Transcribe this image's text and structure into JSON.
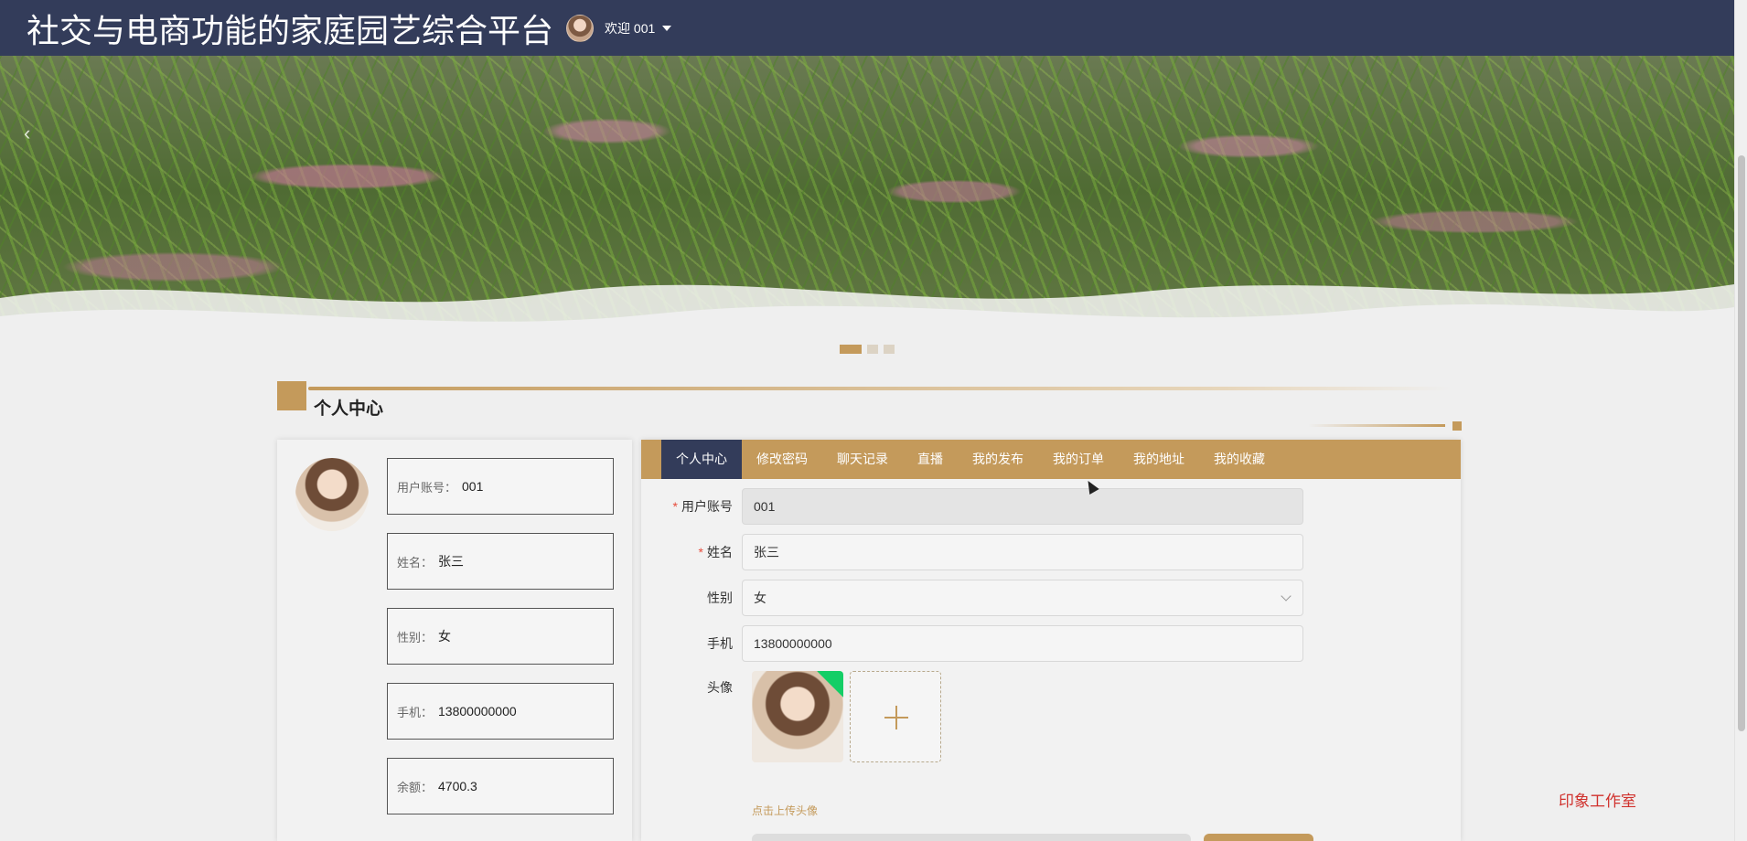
{
  "header": {
    "site_title": "社交与电商功能的家庭园艺综合平台",
    "welcome_text": "欢迎 001"
  },
  "banner": {
    "prev_arrow": "‹",
    "slides_count": 3,
    "active_slide": 1
  },
  "section": {
    "title": "个人中心"
  },
  "profile_summary": {
    "items": [
      {
        "label": "用户账号：",
        "value": "001"
      },
      {
        "label": "姓名：",
        "value": "张三"
      },
      {
        "label": "性别：",
        "value": "女"
      },
      {
        "label": "手机：",
        "value": "13800000000"
      },
      {
        "label": "余额：",
        "value": "4700.3"
      }
    ]
  },
  "tabs": [
    {
      "label": "个人中心",
      "active": true
    },
    {
      "label": "修改密码",
      "active": false
    },
    {
      "label": "聊天记录",
      "active": false
    },
    {
      "label": "直播",
      "active": false
    },
    {
      "label": "我的发布",
      "active": false
    },
    {
      "label": "我的订单",
      "active": false
    },
    {
      "label": "我的地址",
      "active": false
    },
    {
      "label": "我的收藏",
      "active": false
    }
  ],
  "form": {
    "account": {
      "label": "用户账号",
      "value": "001",
      "required": true
    },
    "name": {
      "label": "姓名",
      "value": "张三",
      "required": true
    },
    "gender": {
      "label": "性别",
      "value": "女"
    },
    "phone": {
      "label": "手机",
      "value": "13800000000"
    },
    "avatar": {
      "label": "头像",
      "tip": "点击上传头像"
    }
  },
  "watermark": "印象工作室",
  "colors": {
    "header_bg": "#333c5a",
    "accent": "#c49a5b",
    "page_bg": "#efefef",
    "required": "#e74c3c",
    "success": "#13ce66",
    "watermark": "#d0312d"
  }
}
